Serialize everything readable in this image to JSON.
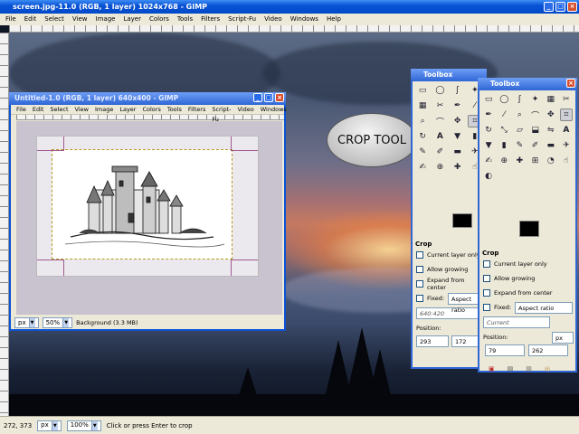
{
  "main_window": {
    "title": "screen.jpg-11.0 (RGB, 1 layer) 1024x768 - GIMP",
    "menu": [
      "File",
      "Edit",
      "Select",
      "View",
      "Image",
      "Layer",
      "Colors",
      "Tools",
      "Filters",
      "Script-Fu",
      "Video",
      "Windows",
      "Help"
    ],
    "status": {
      "coords": "272, 373",
      "unit": "px",
      "zoom": "100%",
      "message": "Click or press Enter to crop"
    }
  },
  "image_window": {
    "title": "Untitled-1.0 (RGB, 1 layer) 640x400 - GIMP",
    "menu": [
      "File",
      "Edit",
      "Select",
      "View",
      "Image",
      "Layer",
      "Colors",
      "Tools",
      "Filters",
      "Script-Fu",
      "Video",
      "Windows"
    ],
    "status": {
      "unit": "px",
      "zoom": "50%",
      "layer": "Background (3.3 MB)"
    }
  },
  "callout": {
    "text": "CROP TOOL"
  },
  "toolbox_back": {
    "title": "Toolbox",
    "options_title": "Crop",
    "options": [
      "Current layer only",
      "Allow growing",
      "Expand from center"
    ],
    "fixed_label": "Fixed:",
    "fixed_value": "Aspect ratio",
    "ratio_value": "640:420",
    "position_label": "Position:",
    "pos_x": "293",
    "pos_y": "172"
  },
  "toolbox_front": {
    "title": "Toolbox",
    "options_title": "Crop",
    "options": [
      "Current layer only",
      "Allow growing",
      "Expand from center"
    ],
    "fixed_label": "Fixed:",
    "fixed_value": "Aspect ratio",
    "current_value": "Current",
    "position_label": "Position:",
    "unit": "px",
    "pos_x": "79",
    "pos_y": "262"
  },
  "colors": {
    "titlebar": "#0a53d6",
    "chrome": "#ece9d8",
    "crop_handle": "#a05890"
  }
}
